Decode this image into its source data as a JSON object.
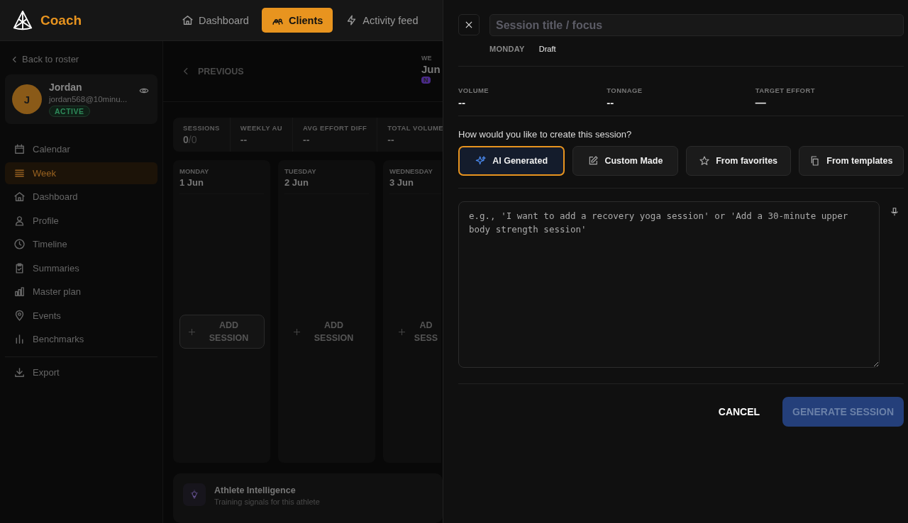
{
  "app": {
    "name": "Coach"
  },
  "nav": [
    {
      "label": "Dashboard",
      "selected": false
    },
    {
      "label": "Clients",
      "selected": true
    },
    {
      "label": "Activity feed",
      "selected": false
    }
  ],
  "sidebar": {
    "back": "Back to roster",
    "client": {
      "initial": "J",
      "name": "Jordan",
      "email": "jordan568@10minu...",
      "status": "ACTIVE"
    },
    "items": [
      {
        "label": "Calendar",
        "selected": false
      },
      {
        "label": "Week",
        "selected": true
      },
      {
        "label": "Dashboard",
        "selected": false
      },
      {
        "label": "Profile",
        "selected": false
      },
      {
        "label": "Timeline",
        "selected": false
      },
      {
        "label": "Summaries",
        "selected": false
      },
      {
        "label": "Master plan",
        "selected": false
      },
      {
        "label": "Events",
        "selected": false
      },
      {
        "label": "Benchmarks",
        "selected": false
      }
    ],
    "footer": [
      {
        "label": "Export",
        "selected": false
      }
    ]
  },
  "week": {
    "previous": "PREVIOUS",
    "label": "WE",
    "range": "Jun",
    "badge": "N"
  },
  "stats": [
    {
      "label": "SESSIONS",
      "value": "0",
      "suffix": "/0"
    },
    {
      "label": "WEEKLY AU",
      "value": "--"
    },
    {
      "label": "AVG EFFORT DIFF",
      "value": "--"
    },
    {
      "label": "TOTAL VOLUME",
      "value": "--"
    }
  ],
  "days": [
    {
      "weekday": "MONDAY",
      "date": "1 Jun",
      "add": "ADD SESSION",
      "hover": true
    },
    {
      "weekday": "TUESDAY",
      "date": "2 Jun",
      "add": "ADD SESSION",
      "hover": false
    },
    {
      "weekday": "WEDNESDAY",
      "date": "3 Jun",
      "add": "AD SESS",
      "hover": false
    }
  ],
  "intelligence": {
    "title": "Athlete Intelligence",
    "subtitle": "Training signals for this athlete"
  },
  "drawer": {
    "title": {
      "placeholder": "Session title / focus"
    },
    "day": "MONDAY",
    "status": "Draft",
    "metrics": [
      {
        "label": "VOLUME",
        "value": "--"
      },
      {
        "label": "TONNAGE",
        "value": "--"
      },
      {
        "label": "TARGET EFFORT",
        "value": "—"
      }
    ],
    "question": "How would you like to create this session?",
    "methods": [
      {
        "label": "AI Generated",
        "selected": true
      },
      {
        "label": "Custom Made",
        "selected": false
      },
      {
        "label": "From favorites",
        "selected": false
      },
      {
        "label": "From templates",
        "selected": false
      }
    ],
    "prompt": {
      "placeholder": "e.g., 'I want to add a recovery yoga session' or 'Add a 30-minute upper body strength session'"
    },
    "cancel": "CANCEL",
    "generate": {
      "label": "GENERATE SESSION",
      "disabled": true
    }
  }
}
